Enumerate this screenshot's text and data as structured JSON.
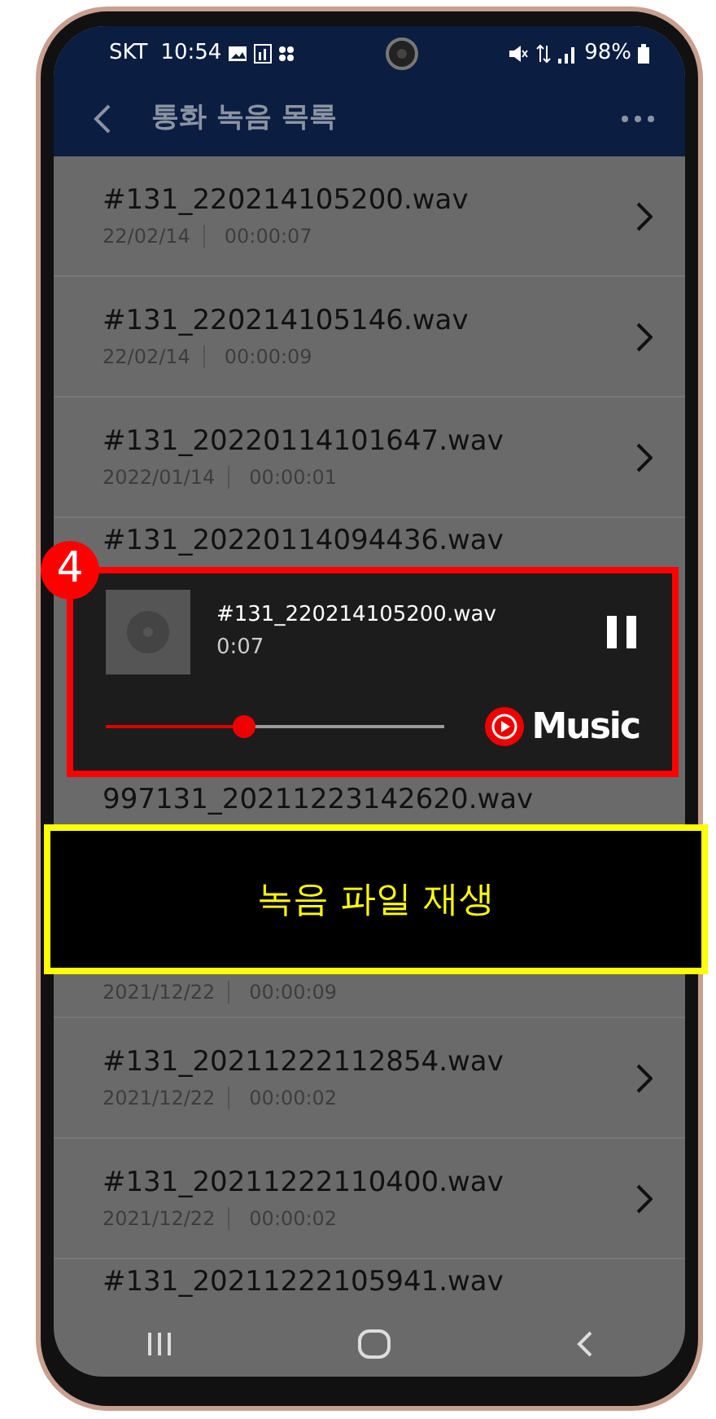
{
  "status_bar": {
    "carrier": "SKT",
    "time": "10:54",
    "battery": "98%"
  },
  "header": {
    "title": "통화 녹음 목록"
  },
  "items": [
    {
      "kind": "recording",
      "name": "#131_220214105200.wav",
      "date": "22/02/14",
      "duration": "00:00:07"
    },
    {
      "kind": "recording",
      "name": "#131_220214105146.wav",
      "date": "22/02/14",
      "duration": "00:00:09"
    },
    {
      "kind": "recording",
      "name": "#131_20220114101647.wav",
      "date": "2022/01/14",
      "duration": "00:00:01"
    },
    {
      "kind": "name_only",
      "name": "#131_20220114094436.wav"
    },
    {
      "kind": "player",
      "step": "4",
      "track": "#131_220214105200.wav",
      "elapsed": "0:07",
      "level": 0.41,
      "brand": "Music"
    },
    {
      "kind": "name_only",
      "name": "997131_20211223142620.wav"
    },
    {
      "kind": "caption",
      "text": "녹음 파일 재생"
    },
    {
      "kind": "meta_only",
      "date": "2021/12/22",
      "duration": "00:00:09"
    },
    {
      "kind": "recording",
      "name": "#131_20211222112854.wav",
      "date": "2021/12/22",
      "duration": "00:00:02"
    },
    {
      "kind": "recording",
      "name": "#131_20211222110400.wav",
      "date": "2021/12/22",
      "duration": "00:00:02"
    },
    {
      "kind": "name_only",
      "name": "#131_20211222105941.wav"
    }
  ]
}
